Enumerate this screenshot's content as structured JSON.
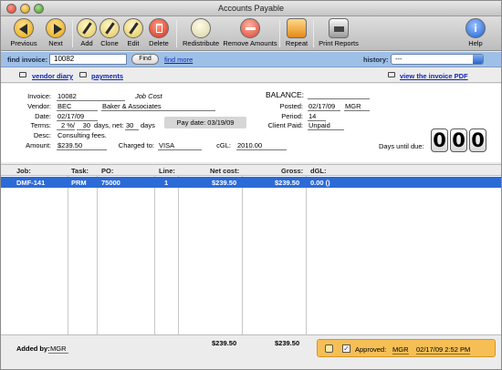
{
  "window": {
    "title": "Accounts Payable"
  },
  "toolbar": {
    "previous": "Previous",
    "next": "Next",
    "add": "Add",
    "clone": "Clone",
    "edit": "Edit",
    "delete": "Delete",
    "redistribute": "Redistribute",
    "remove_amounts": "Remove Amounts",
    "repeat": "Repeat",
    "print_reports": "Print Reports",
    "help": "Help"
  },
  "findbar": {
    "label": "find invoice:",
    "value": "10082",
    "find_button": "Find",
    "more_link": "find more",
    "history_label": "history:",
    "history_value": "---"
  },
  "links": {
    "vendor_diary": "vendor diary",
    "payments": "payments",
    "view_pdf": "view the invoice PDF"
  },
  "invoice": {
    "invoice_label": "Invoice:",
    "invoice": "10082",
    "type": "Job Cost",
    "vendor_label": "Vendor:",
    "vendor_code": "BEC",
    "vendor_name": "Baker & Associates",
    "date_label": "Date:",
    "date": "02/17/09",
    "terms_label": "Terms:",
    "terms_pct": "2 %/",
    "terms_days": "30",
    "terms_net_label": "days, net:",
    "terms_net": "30",
    "days_label": "days",
    "paydate": "Pay date: 03/19/09",
    "desc_label": "Desc:",
    "desc": "Consulting fees.",
    "amount_label": "Amount:",
    "amount": "$239.50",
    "charged_label": "Charged to:",
    "charged": "VISA",
    "cgl_label": "cGL:",
    "cgl": "2010.00",
    "balance_label": "BALANCE:",
    "balance": "",
    "posted_label": "Posted:",
    "posted_date": "02/17/09",
    "posted_by": "MGR",
    "period_label": "Period:",
    "period": "14",
    "client_paid_label": "Client Paid:",
    "client_paid": "Unpaid",
    "days_due_label": "Days until due:",
    "days_due_digits": [
      "0",
      "0",
      "0"
    ]
  },
  "table": {
    "headers": {
      "job": "Job:",
      "task": "Task:",
      "po": "PO:",
      "line": "Line:",
      "net": "Net cost:",
      "gross": "Gross:",
      "dgl": "dGL:"
    },
    "rows": [
      {
        "job": "DMF-141",
        "task": "PRM",
        "po": "75000",
        "line": "1",
        "net": "$239.50",
        "gross": "$239.50",
        "dgl": "0.00 ()"
      }
    ]
  },
  "footer": {
    "added_label": "Added by:",
    "added_by": "MGR",
    "net_total": "$239.50",
    "gross_total": "$239.50",
    "approved_label": "Approved:",
    "approved_by": "MGR",
    "approved_when": "02/17/09 2:52 PM"
  }
}
